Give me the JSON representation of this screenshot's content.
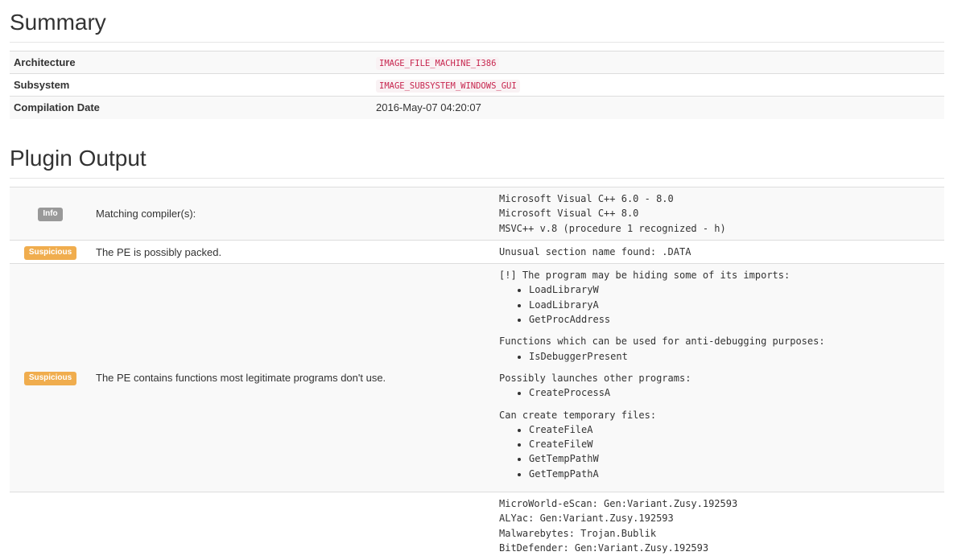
{
  "summary": {
    "title": "Summary",
    "rows": [
      {
        "key": "Architecture",
        "value": "IMAGE_FILE_MACHINE_I386"
      },
      {
        "key": "Subsystem",
        "value": "IMAGE_SUBSYSTEM_WINDOWS_GUI"
      },
      {
        "key": "Compilation Date",
        "value": "2016-May-07 04:20:07"
      }
    ]
  },
  "plugin": {
    "title": "Plugin Output",
    "rows": [
      {
        "level": "Info",
        "description": "Matching compiler(s):",
        "output": "Microsoft Visual C++ 6.0 - 8.0\nMicrosoft Visual C++ 8.0\nMSVC++ v.8 (procedure 1 recognized - h)"
      },
      {
        "level": "Suspicious",
        "description": "The PE is possibly packed.",
        "output": "Unusual section name found: .DATA"
      },
      {
        "level": "Suspicious",
        "description": "The PE contains functions most legitimate programs don't use.",
        "groups": [
          {
            "heading": "[!] The program may be hiding some of its imports:",
            "items": [
              "LoadLibraryW",
              "LoadLibraryA",
              "GetProcAddress"
            ]
          },
          {
            "heading": "Functions which can be used for anti-debugging purposes:",
            "items": [
              "IsDebuggerPresent"
            ]
          },
          {
            "heading": "Possibly launches other programs:",
            "items": [
              "CreateProcessA"
            ]
          },
          {
            "heading": "Can create temporary files:",
            "items": [
              "CreateFileA",
              "CreateFileW",
              "GetTempPathW",
              "GetTempPathA"
            ]
          }
        ]
      },
      {
        "level": "",
        "description": "",
        "output": "MicroWorld-eScan: Gen:Variant.Zusy.192593\nALYac: Gen:Variant.Zusy.192593\nMalwarebytes: Trojan.Bublik\nBitDefender: Gen:Variant.Zusy.192593"
      }
    ]
  },
  "colors": {
    "info_badge": "#999999",
    "suspicious_badge": "#f0ad4e",
    "code_text": "#c7254e",
    "code_bg": "#f9f2f4"
  }
}
